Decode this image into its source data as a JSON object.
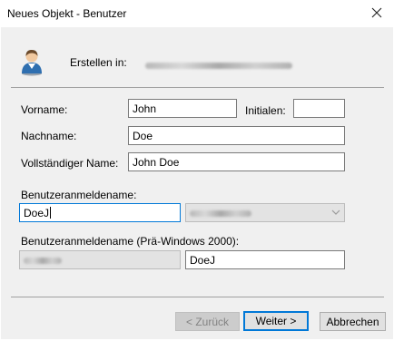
{
  "window": {
    "title": "Neues Objekt - Benutzer",
    "close_icon": "close-icon"
  },
  "header": {
    "icon": "user-icon",
    "create_in_label": "Erstellen in:",
    "create_in_value": "[blurred path]"
  },
  "form": {
    "first_name_label": "Vorname:",
    "first_name_value": "John",
    "initials_label": "Initialen:",
    "initials_value": "",
    "last_name_label": "Nachname:",
    "last_name_value": "Doe",
    "full_name_label": "Vollständiger Name:",
    "full_name_value": "John Doe",
    "logon_name_label": "Benutzeranmeldename:",
    "logon_name_value": "DoeJ",
    "domain_suffix_value": "[blurred domain]",
    "pre2000_label": "Benutzeranmeldename (Prä-Windows 2000):",
    "pre2000_domain_value": "[blurred domain]",
    "pre2000_name_value": "DoeJ"
  },
  "buttons": {
    "back": "< Zurück",
    "next": "Weiter >",
    "cancel": "Abbrechen"
  },
  "colors": {
    "focus_border": "#0078d7",
    "dialog_background": "#f0f0f0"
  }
}
